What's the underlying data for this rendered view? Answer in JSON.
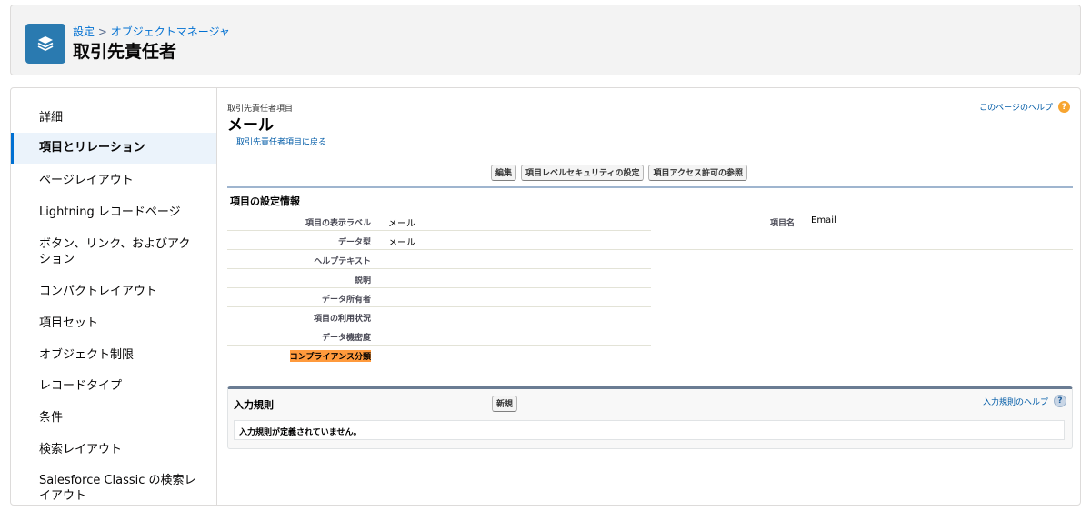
{
  "header": {
    "breadcrumb_setup": "設定",
    "breadcrumb_sep": " > ",
    "breadcrumb_object_manager": "オブジェクトマネージャ",
    "title": "取引先責任者",
    "logo_icon": "layers-icon",
    "accent_color": "#2a7ab0"
  },
  "sidebar": {
    "items": [
      {
        "label": "詳細",
        "active": false
      },
      {
        "label": "項目とリレーション",
        "active": true
      },
      {
        "label": "ページレイアウト",
        "active": false
      },
      {
        "label": "Lightning レコードページ",
        "active": false
      },
      {
        "label": "ボタン、リンク、およびアクション",
        "active": false
      },
      {
        "label": "コンパクトレイアウト",
        "active": false
      },
      {
        "label": "項目セット",
        "active": false
      },
      {
        "label": "オブジェクト制限",
        "active": false
      },
      {
        "label": "レコードタイプ",
        "active": false
      },
      {
        "label": "条件",
        "active": false
      },
      {
        "label": "検索レイアウト",
        "active": false
      },
      {
        "label": "Salesforce Classic の検索レイアウト",
        "active": false
      }
    ]
  },
  "main": {
    "object_field_label": "取引先責任者項目",
    "field_title": "メール",
    "back_link": "取引先責任者項目に戻る",
    "page_help": "このページのヘルプ",
    "buttons": {
      "edit": "編集",
      "field_level_security": "項目レベルセキュリティの設定",
      "view_field_access": "項目アクセス許可の参照"
    },
    "section_title": "項目の設定情報",
    "fields": [
      {
        "label": "項目の表示ラベル",
        "value": "メール"
      },
      {
        "label": "データ型",
        "value": "メール"
      },
      {
        "label": "ヘルプテキスト",
        "value": ""
      },
      {
        "label": "説明",
        "value": ""
      },
      {
        "label": "データ所有者",
        "value": ""
      },
      {
        "label": "項目の利用状況",
        "value": ""
      },
      {
        "label": "データ機密度",
        "value": ""
      },
      {
        "label": "コンプライアンス分類",
        "value": "",
        "highlight": true
      }
    ],
    "right_field": {
      "label": "項目名",
      "value": "Email"
    },
    "validation_rules": {
      "title": "入力規則",
      "new_button": "新規",
      "help": "入力規則のヘルプ",
      "empty_message": "入力規則が定義されていません。"
    }
  }
}
